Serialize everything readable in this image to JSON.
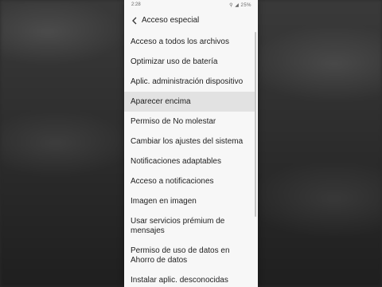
{
  "status": {
    "time": "2:28",
    "system": "⚲ ◢ 25%"
  },
  "appbar": {
    "title": "Acceso especial",
    "back_icon": "chevron-left-icon"
  },
  "items": [
    {
      "label": "Acceso a todos los archivos"
    },
    {
      "label": "Optimizar uso de batería"
    },
    {
      "label": "Aplic. administración dispositivo"
    },
    {
      "label": "Aparecer encima",
      "state": "pressed"
    },
    {
      "label": "Permiso de No molestar"
    },
    {
      "label": "Cambiar los ajustes del sistema"
    },
    {
      "label": "Notificaciones adaptables"
    },
    {
      "label": "Acceso a notificaciones"
    },
    {
      "label": "Imagen en imagen"
    },
    {
      "label": "Usar servicios prémium de mensajes"
    },
    {
      "label": "Permiso de uso de datos en Ahorro de datos"
    },
    {
      "label": "Instalar aplic. desconocidas"
    }
  ],
  "colors": {
    "highlight": "#e2e2e2",
    "background": "#f7f7f7",
    "text": "#1f1f1f"
  }
}
